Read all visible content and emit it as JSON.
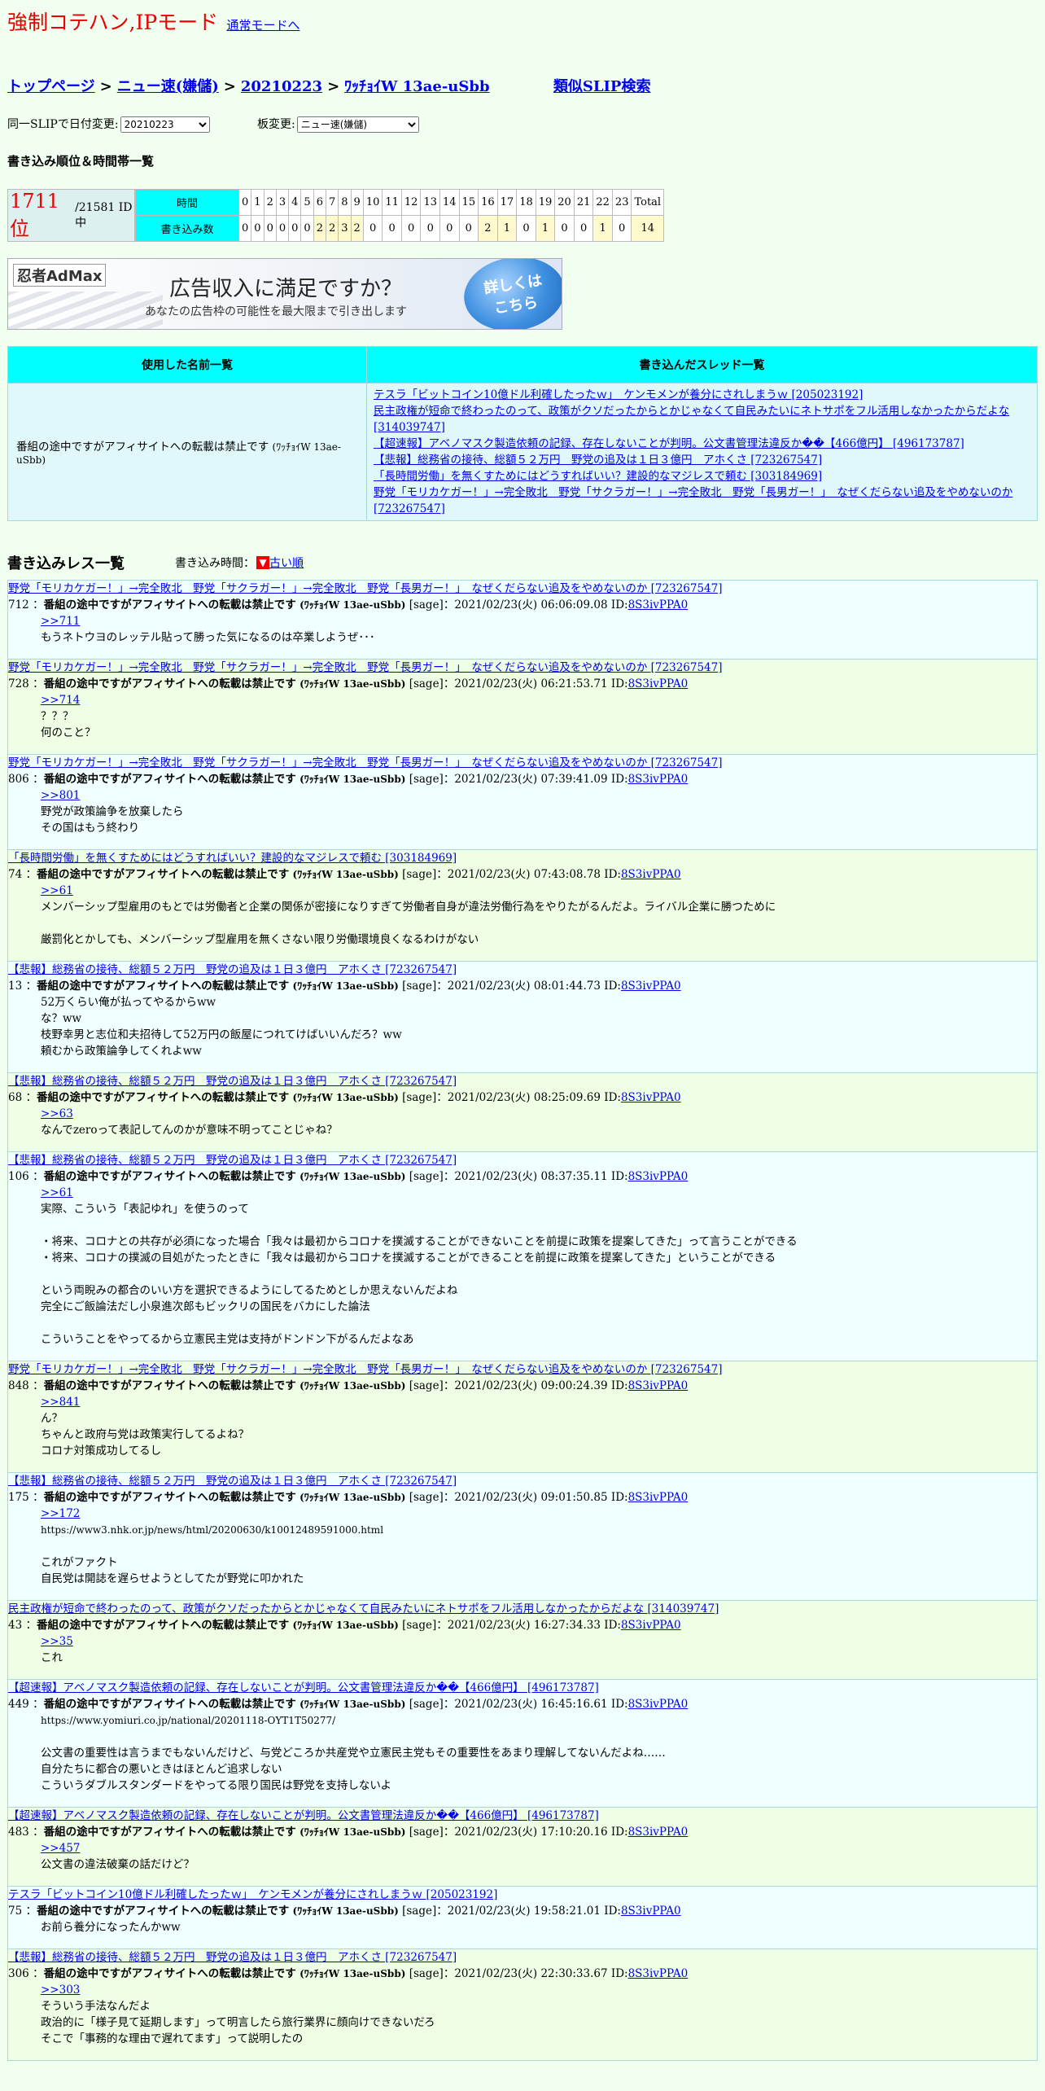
{
  "mode": {
    "title": "強制コテハン,IPモード",
    "switch_link": "通常モードへ"
  },
  "breadcrumb": {
    "items": [
      "トップページ",
      "ニュー速(嫌儲)",
      "20210223",
      "ﾜｯﾁｮｲW 13ae-uSbb"
    ],
    "separator": ">",
    "similar": "類似SLIP検索"
  },
  "selectors": {
    "date_label": "同一SLIPで日付変更:",
    "date_value": "20210223",
    "board_label": "板変更:",
    "board_value": "ニュー速(嫌儲)"
  },
  "rank": {
    "heading": "書き込み順位＆時間帯一覧",
    "rank": "1711 位",
    "total": "/21581 ID中",
    "row_time": "時間",
    "row_count": "書き込み数",
    "hours": [
      "0",
      "1",
      "2",
      "3",
      "4",
      "5",
      "6",
      "7",
      "8",
      "9",
      "10",
      "11",
      "12",
      "13",
      "14",
      "15",
      "16",
      "17",
      "18",
      "19",
      "20",
      "21",
      "22",
      "23",
      "Total"
    ],
    "counts": [
      "0",
      "0",
      "0",
      "0",
      "0",
      "0",
      "2",
      "2",
      "3",
      "2",
      "0",
      "0",
      "0",
      "0",
      "0",
      "0",
      "2",
      "1",
      "0",
      "1",
      "0",
      "0",
      "1",
      "0",
      "14"
    ]
  },
  "ad": {
    "brand": "忍者AdMax",
    "headline": "広告収入に満足ですか？",
    "sub": "あなたの広告枠の可能性を最大限まで引き出します",
    "button": [
      "詳しくは",
      "こちら"
    ]
  },
  "summary": {
    "names_header": "使用した名前一覧",
    "threads_header": "書き込んだスレッド一覧",
    "name": "番組の途中ですがアフィサイトへの転載は禁止です",
    "name_slip": "(ﾜｯﾁｮｲW 13ae-uSbb)",
    "threads": [
      "テスラ「ビットコイン10億ドル利確したったｗ」　ケンモメンが養分にされしまうｗ [205023192]",
      "民主政権が短命で終わったのって、政策がクソだったからとかじゃなくて自民みたいにネトサポをフル活用しなかったからだよな [314039747]",
      "【超速報】アベノマスク製造依頼の記録、存在しないことが判明。公文書管理法違反か��【466億円】 [496173787]",
      "【悲報】総務省の接待、総額５２万円　野党の追及は１日３億円　アホくさ [723267547]",
      "「長時間労働」を無くすためにはどうすればいい？建設的なマジレスで頼む [303184969]",
      "野党「モリカケガー！」→完全敗北　野党「サクラガー！」→完全敗北　野党「長男ガー！」　なぜくだらない追及をやめないのか [723267547]"
    ]
  },
  "posts_section": {
    "title": "書き込みレス一覧",
    "order_label": "書き込み時間：",
    "order_icon": "▼",
    "order_link": "古い順"
  },
  "posts": [
    {
      "thread": "野党「モリカケガー！」→完全敗北　野党「サクラガー！」→完全敗北　野党「長男ガー！」　なぜくだらない追及をやめないのか [723267547]",
      "num": "712",
      "name": "番組の途中ですがアフィサイトへの転載は禁止です",
      "slip": "(ﾜｯﾁｮｲW 13ae-uSbb)",
      "meta": "[sage]：2021/02/23(火) 06:06:09.08 ID:",
      "id": "8S3ivPPA0",
      "lines": [
        {
          "text": ">>711",
          "link": true
        },
        {
          "text": "もうネトウヨのレッテル貼って勝った気になるのは卒業しようぜ･･･"
        }
      ]
    },
    {
      "thread": "野党「モリカケガー！」→完全敗北　野党「サクラガー！」→完全敗北　野党「長男ガー！」　なぜくだらない追及をやめないのか [723267547]",
      "num": "728",
      "name": "番組の途中ですがアフィサイトへの転載は禁止です",
      "slip": "(ﾜｯﾁｮｲW 13ae-uSbb)",
      "meta": "[sage]：2021/02/23(火) 06:21:53.71 ID:",
      "id": "8S3ivPPA0",
      "lines": [
        {
          "text": ">>714",
          "link": true
        },
        {
          "text": "？？？"
        },
        {
          "text": "何のこと？"
        }
      ]
    },
    {
      "thread": "野党「モリカケガー！」→完全敗北　野党「サクラガー！」→完全敗北　野党「長男ガー！」　なぜくだらない追及をやめないのか [723267547]",
      "num": "806",
      "name": "番組の途中ですがアフィサイトへの転載は禁止です",
      "slip": "(ﾜｯﾁｮｲW 13ae-uSbb)",
      "meta": "[sage]：2021/02/23(火) 07:39:41.09 ID:",
      "id": "8S3ivPPA0",
      "lines": [
        {
          "text": ">>801",
          "link": true
        },
        {
          "text": "野党が政策論争を放棄したら"
        },
        {
          "text": "その国はもう終わり"
        }
      ]
    },
    {
      "thread": "「長時間労働」を無くすためにはどうすればいい？建設的なマジレスで頼む [303184969]",
      "num": "74",
      "name": "番組の途中ですがアフィサイトへの転載は禁止です",
      "slip": "(ﾜｯﾁｮｲW 13ae-uSbb)",
      "meta": "[sage]：2021/02/23(火) 07:43:08.78 ID:",
      "id": "8S3ivPPA0",
      "lines": [
        {
          "text": ">>61",
          "link": true
        },
        {
          "text": "メンバーシップ型雇用のもとでは労働者と企業の関係が密接になりすぎて労働者自身が違法労働行為をやりたがるんだよ。ライバル企業に勝つために"
        },
        {
          "text": ""
        },
        {
          "text": "厳罰化とかしても、メンバーシップ型雇用を無くさない限り労働環境良くなるわけがない"
        }
      ]
    },
    {
      "thread": "【悲報】総務省の接待、総額５２万円　野党の追及は１日３億円　アホくさ [723267547]",
      "num": "13",
      "name": "番組の途中ですがアフィサイトへの転載は禁止です",
      "slip": "(ﾜｯﾁｮｲW 13ae-uSbb)",
      "meta": "[sage]：2021/02/23(火) 08:01:44.73 ID:",
      "id": "8S3ivPPA0",
      "lines": [
        {
          "text": "52万くらい俺が払ってやるからww"
        },
        {
          "text": "な？ww"
        },
        {
          "text": "枝野幸男と志位和夫招待して52万円の飯屋につれてけばいいんだろ？ww"
        },
        {
          "text": "頼むから政策論争してくれよww"
        }
      ]
    },
    {
      "thread": "【悲報】総務省の接待、総額５２万円　野党の追及は１日３億円　アホくさ [723267547]",
      "num": "68",
      "name": "番組の途中ですがアフィサイトへの転載は禁止です",
      "slip": "(ﾜｯﾁｮｲW 13ae-uSbb)",
      "meta": "[sage]：2021/02/23(火) 08:25:09.69 ID:",
      "id": "8S3ivPPA0",
      "lines": [
        {
          "text": ">>63",
          "link": true
        },
        {
          "text": "なんでzeroって表記してんのかが意味不明ってことじゃね？"
        }
      ]
    },
    {
      "thread": "【悲報】総務省の接待、総額５２万円　野党の追及は１日３億円　アホくさ [723267547]",
      "num": "106",
      "name": "番組の途中ですがアフィサイトへの転載は禁止です",
      "slip": "(ﾜｯﾁｮｲW 13ae-uSbb)",
      "meta": "[sage]：2021/02/23(火) 08:37:35.11 ID:",
      "id": "8S3ivPPA0",
      "lines": [
        {
          "text": ">>61",
          "link": true
        },
        {
          "text": "実際、こういう「表記ゆれ」を使うのって"
        },
        {
          "text": ""
        },
        {
          "text": "・将来、コロナとの共存が必須になった場合「我々は最初からコロナを撲滅することができないことを前提に政策を提案してきた」って言うことができる"
        },
        {
          "text": "・将来、コロナの撲滅の目処がたったときに「我々は最初からコロナを撲滅することができることを前提に政策を提案してきた」ということができる"
        },
        {
          "text": ""
        },
        {
          "text": "という両睨みの都合のいい方を選択できるようにしてるためとしか思えないんだよね"
        },
        {
          "text": "完全にご飯論法だし小泉進次郎もビックリの国民をバカにした論法"
        },
        {
          "text": ""
        },
        {
          "text": "こういうことをやってるから立憲民主党は支持がドンドン下がるんだよなあ"
        }
      ]
    },
    {
      "thread": "野党「モリカケガー！」→完全敗北　野党「サクラガー！」→完全敗北　野党「長男ガー！」　なぜくだらない追及をやめないのか [723267547]",
      "num": "848",
      "name": "番組の途中ですがアフィサイトへの転載は禁止です",
      "slip": "(ﾜｯﾁｮｲW 13ae-uSbb)",
      "meta": "[sage]：2021/02/23(火) 09:00:24.39 ID:",
      "id": "8S3ivPPA0",
      "lines": [
        {
          "text": ">>841",
          "link": true
        },
        {
          "text": "ん？"
        },
        {
          "text": "ちゃんと政府与党は政策実行してるよね？"
        },
        {
          "text": "コロナ対策成功してるし"
        }
      ]
    },
    {
      "thread": "【悲報】総務省の接待、総額５２万円　野党の追及は１日３億円　アホくさ [723267547]",
      "num": "175",
      "name": "番組の途中ですがアフィサイトへの転載は禁止です",
      "slip": "(ﾜｯﾁｮｲW 13ae-uSbb)",
      "meta": "[sage]：2021/02/23(火) 09:01:50.85 ID:",
      "id": "8S3ivPPA0",
      "lines": [
        {
          "text": ">>172",
          "link": true
        },
        {
          "text": "https://www3.nhk.or.jp/news/html/20200630/k10012489591000.html",
          "small": true
        },
        {
          "text": ""
        },
        {
          "text": "これがファクト"
        },
        {
          "text": "自民党は開誌を遅らせようとしてたが野党に叩かれた"
        }
      ]
    },
    {
      "thread": "民主政権が短命で終わったのって、政策がクソだったからとかじゃなくて自民みたいにネトサポをフル活用しなかったからだよな [314039747]",
      "num": "43",
      "name": "番組の途中ですがアフィサイトへの転載は禁止です",
      "slip": "(ﾜｯﾁｮｲW 13ae-uSbb)",
      "meta": "[sage]：2021/02/23(火) 16:27:34.33 ID:",
      "id": "8S3ivPPA0",
      "lines": [
        {
          "text": ">>35",
          "link": true
        },
        {
          "text": "これ"
        }
      ]
    },
    {
      "thread": "【超速報】アベノマスク製造依頼の記録、存在しないことが判明。公文書管理法違反か��【466億円】 [496173787]",
      "num": "449",
      "name": "番組の途中ですがアフィサイトへの転載は禁止です",
      "slip": "(ﾜｯﾁｮｲW 13ae-uSbb)",
      "meta": "[sage]：2021/02/23(火) 16:45:16.61 ID:",
      "id": "8S3ivPPA0",
      "lines": [
        {
          "text": "https://www.yomiuri.co.jp/national/20201118-OYT1T50277/",
          "small": true
        },
        {
          "text": ""
        },
        {
          "text": "公文書の重要性は言うまでもないんだけど、与党どころか共産党や立憲民主党もその重要性をあまり理解してないんだよね……"
        },
        {
          "text": "自分たちに都合の悪いときはほとんど追求しない"
        },
        {
          "text": "こういうダブルスタンダードをやってる限り国民は野党を支持しないよ"
        }
      ]
    },
    {
      "thread": "【超速報】アベノマスク製造依頼の記録、存在しないことが判明。公文書管理法違反か��【466億円】 [496173787]",
      "num": "483",
      "name": "番組の途中ですがアフィサイトへの転載は禁止です",
      "slip": "(ﾜｯﾁｮｲW 13ae-uSbb)",
      "meta": "[sage]：2021/02/23(火) 17:10:20.16 ID:",
      "id": "8S3ivPPA0",
      "lines": [
        {
          "text": ">>457",
          "link": true
        },
        {
          "text": "公文書の違法破棄の話だけど？"
        }
      ]
    },
    {
      "thread": "テスラ「ビットコイン10億ドル利確したったｗ」　ケンモメンが養分にされしまうｗ [205023192]",
      "num": "75",
      "name": "番組の途中ですがアフィサイトへの転載は禁止です",
      "slip": "(ﾜｯﾁｮｲW 13ae-uSbb)",
      "meta": "[sage]：2021/02/23(火) 19:58:21.01 ID:",
      "id": "8S3ivPPA0",
      "lines": [
        {
          "text": "お前ら養分になったんかww"
        }
      ]
    },
    {
      "thread": "【悲報】総務省の接待、総額５２万円　野党の追及は１日３億円　アホくさ [723267547]",
      "num": "306",
      "name": "番組の途中ですがアフィサイトへの転載は禁止です",
      "slip": "(ﾜｯﾁｮｲW 13ae-uSbb)",
      "meta": "[sage]：2021/02/23(火) 22:30:33.67 ID:",
      "id": "8S3ivPPA0",
      "lines": [
        {
          "text": ">>303",
          "link": true
        },
        {
          "text": "そういう手法なんだよ"
        },
        {
          "text": "政治的に「様子見て延期します」って明言したら旅行業界に顔向けできないだろ"
        },
        {
          "text": "そこで「事務的な理由で遅れてます」って説明したの"
        }
      ]
    }
  ]
}
